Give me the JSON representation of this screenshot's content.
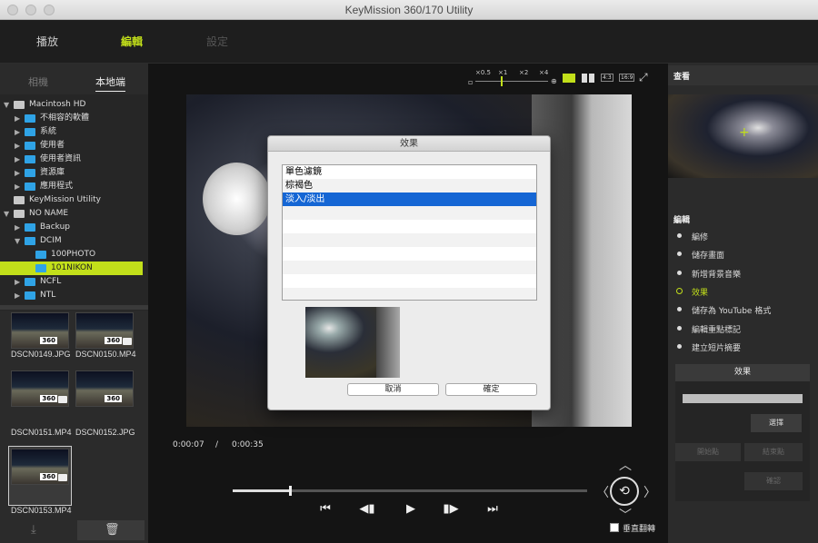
{
  "window": {
    "title": "KeyMission 360/170 Utility"
  },
  "topnav": {
    "tabs": [
      "播放",
      "編輯",
      "設定"
    ],
    "active": "編輯",
    "accent": "#c2df1a"
  },
  "source": {
    "tabs": [
      "相機",
      "本地端"
    ],
    "active": "本地端"
  },
  "tree": [
    {
      "label": "Macintosh HD",
      "type": "drive",
      "indent": 0
    },
    {
      "label": "不相容的軟體",
      "type": "folder",
      "indent": 1
    },
    {
      "label": "系統",
      "type": "folder",
      "indent": 1
    },
    {
      "label": "使用者",
      "type": "folder",
      "indent": 1
    },
    {
      "label": "使用者資訊",
      "type": "folder",
      "indent": 1
    },
    {
      "label": "資源庫",
      "type": "folder",
      "indent": 1
    },
    {
      "label": "應用程式",
      "type": "folder",
      "indent": 1
    },
    {
      "label": "KeyMission Utility",
      "type": "drive",
      "indent": 0
    },
    {
      "label": "NO NAME",
      "type": "drive",
      "indent": 0
    },
    {
      "label": "Backup",
      "type": "folder",
      "indent": 1
    },
    {
      "label": "DCIM",
      "type": "folder",
      "indent": 1
    },
    {
      "label": "100PHOTO",
      "type": "folder",
      "indent": 2
    },
    {
      "label": "101NIKON",
      "type": "folder",
      "indent": 2,
      "selected": true
    },
    {
      "label": "NCFL",
      "type": "folder",
      "indent": 1
    },
    {
      "label": "NTL",
      "type": "folder",
      "indent": 1
    }
  ],
  "thumbnails": [
    {
      "name": "DSCN0149.JPG",
      "badge": "360",
      "video": false
    },
    {
      "name": "DSCN0150.MP4",
      "badge": "360",
      "video": true
    },
    {
      "name": "DSCN0151.MP4",
      "badge": "360",
      "video": true
    },
    {
      "name": "DSCN0152.JPG",
      "badge": "360",
      "video": false
    },
    {
      "name": "DSCN0153.MP4",
      "badge": "360",
      "video": true,
      "selected": true
    }
  ],
  "zoom": {
    "labels": [
      "×0.5",
      "×1",
      "×2",
      "×4"
    ],
    "views": [
      "4:3",
      "16:9"
    ]
  },
  "player": {
    "current": "0:00:07",
    "separator": "/",
    "total": "0:00:35",
    "progress": 0.16
  },
  "flip": {
    "label": "垂直翻轉"
  },
  "right": {
    "view_header": "查看",
    "edit_header": "編輯",
    "menu": [
      "編修",
      "儲存畫面",
      "新增背景音樂",
      "效果",
      "儲存為 YouTube 格式",
      "編輯重點標記",
      "建立短片摘要"
    ],
    "active_menu": "效果",
    "effect_header": "效果",
    "select_button": "選擇",
    "start_button": "開始點",
    "end_button": "結束點",
    "confirm_button": "確認"
  },
  "dialog": {
    "title": "效果",
    "items": [
      "單色濾鏡",
      "棕褐色",
      "淡入/淡出"
    ],
    "selected": "淡入/淡出",
    "cancel": "取消",
    "ok": "確定"
  }
}
